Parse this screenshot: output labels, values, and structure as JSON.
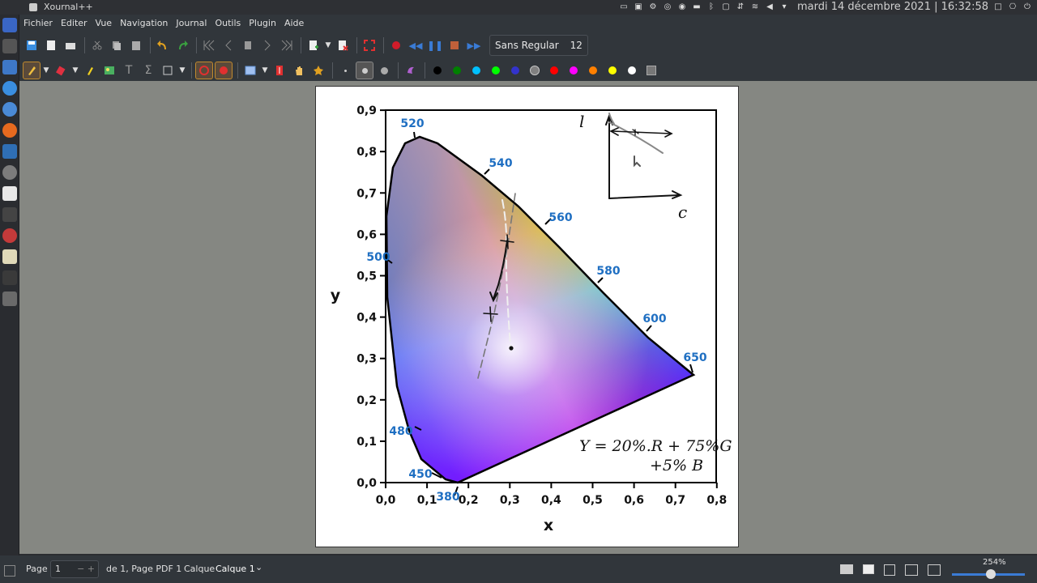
{
  "topbar": {
    "window_title": "Xournal++",
    "clock": "mardi 14 décembre 2021 | 16:32:58"
  },
  "menu": {
    "items": [
      "Fichier",
      "Editer",
      "Vue",
      "Navigation",
      "Journal",
      "Outils",
      "Plugin",
      "Aide"
    ]
  },
  "toolbar": {
    "font_name": "Sans Regular",
    "font_size": "12"
  },
  "palette": {
    "colors": [
      "#000000",
      "#008000",
      "#00c0ff",
      "#00ff00",
      "#3333cc",
      "#808080",
      "#ff0000",
      "#ff00ff",
      "#ff8000",
      "#ffff00",
      "#ffffff"
    ]
  },
  "chart": {
    "x_axis_label": "x",
    "y_axis_label": "y",
    "x_ticks": [
      "0,0",
      "0,1",
      "0,2",
      "0,3",
      "0,4",
      "0,5",
      "0,6",
      "0,7",
      "0,8"
    ],
    "y_ticks": [
      "0,0",
      "0,1",
      "0,2",
      "0,3",
      "0,4",
      "0,5",
      "0,6",
      "0,7",
      "0,8",
      "0,9"
    ],
    "wavelengths": [
      "380",
      "450",
      "480",
      "500",
      "520",
      "540",
      "560",
      "580",
      "600",
      "650"
    ],
    "wavelength_color": "#1f6fc2"
  },
  "annotations": {
    "formula_line1": "Y = 20%.R + 75%G",
    "formula_line2": "+5% B",
    "inset_l": "l",
    "inset_c": "c"
  },
  "statusbar": {
    "page_label": "Page",
    "page_value": "1",
    "page_of": "de 1, Page PDF 1",
    "layer_label": "Calque",
    "layer_value": "Calque 1",
    "zoom": "254%"
  }
}
